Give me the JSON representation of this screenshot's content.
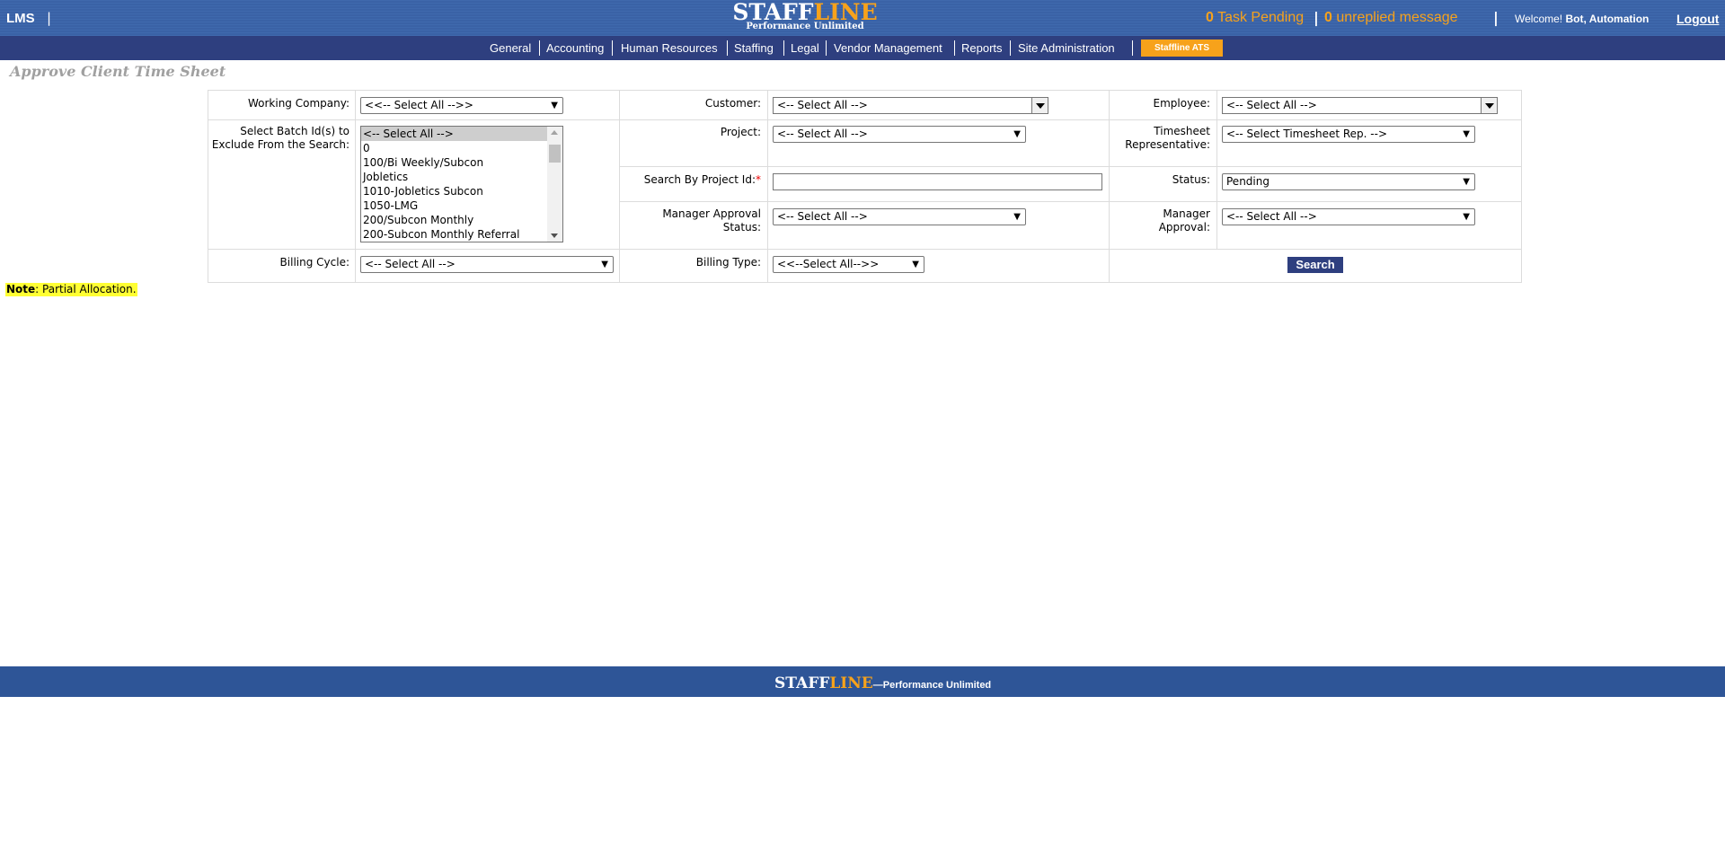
{
  "header": {
    "app_name": "LMS",
    "separator": "|",
    "logo_part1": "STAFF",
    "logo_part2": "LINE",
    "logo_tagline": "Performance Unlimited",
    "task_count": "0",
    "task_label": "Task Pending",
    "message_count": "0",
    "message_label": "unreplied message",
    "welcome_label": "Welcome!",
    "user_name": "Bot, Automation",
    "logout_label": "Logout"
  },
  "nav": {
    "items": [
      "General",
      "Accounting",
      "Human Resources",
      "Staffing",
      "Legal",
      "Vendor Management",
      "Reports",
      "Site Administration"
    ],
    "ats_label": "Staffline ATS"
  },
  "page": {
    "title": "Approve Client Time Sheet"
  },
  "filters": {
    "working_company": {
      "label": "Working Company:",
      "value": "<<-- Select All -->>"
    },
    "customer": {
      "label": "Customer:",
      "value": "<-- Select All -->"
    },
    "employee": {
      "label": "Employee:",
      "value": "<-- Select All -->"
    },
    "batch": {
      "label": "Select Batch Id(s) to Exclude From the Search:",
      "options": [
        "<-- Select All -->",
        "0",
        "100/Bi Weekly/Subcon",
        "Jobletics",
        "1010-Jobletics Subcon",
        "1050-LMG",
        "200/Subcon Monthly",
        "200-Subcon Monthly Referral"
      ]
    },
    "project": {
      "label": "Project:",
      "value": "<-- Select All -->"
    },
    "timesheet_rep": {
      "label": "Timesheet Representative:",
      "value": "<-- Select Timesheet Rep. -->"
    },
    "project_id": {
      "label": "Search By Project Id:",
      "required_mark": "*",
      "value": ""
    },
    "status": {
      "label": "Status:",
      "value": "Pending"
    },
    "manager_approval_status": {
      "label": "Manager Approval Status:",
      "value": "<-- Select All -->"
    },
    "manager_approval": {
      "label": "Manager Approval:",
      "value": "<-- Select All -->"
    },
    "billing_cycle": {
      "label": "Billing Cycle:",
      "value": "<-- Select All -->"
    },
    "billing_type": {
      "label": "Billing Type:",
      "value": "<<--Select All-->>"
    },
    "search_label": "Search"
  },
  "note": {
    "prefix": "Note",
    "text": ": Partial Allocation."
  },
  "footer": {
    "logo_part1": "STAFF",
    "logo_part2": "LINE",
    "tagline": "—Performance Unlimited"
  }
}
